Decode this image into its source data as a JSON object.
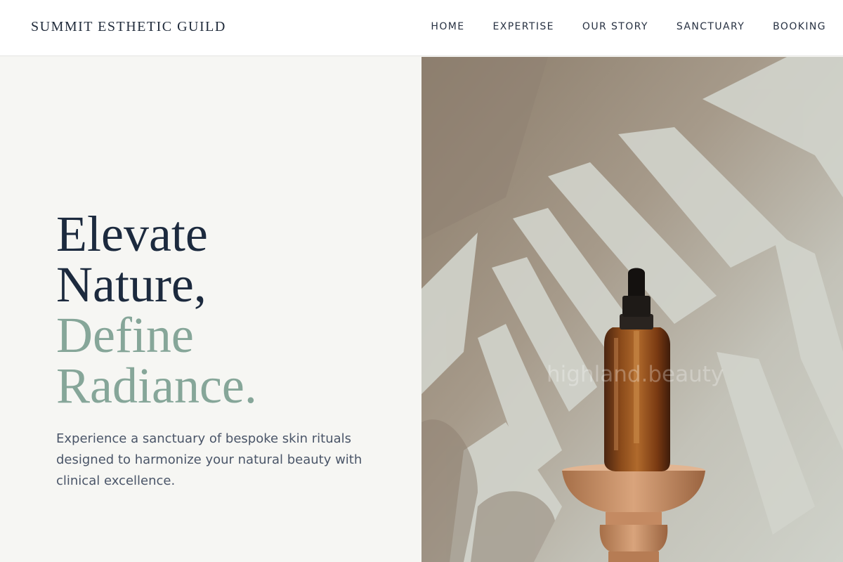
{
  "header": {
    "brand": "SUMMIT ESTHETIC GUILD",
    "nav": [
      {
        "label": "HOME"
      },
      {
        "label": "EXPERTISE"
      },
      {
        "label": "OUR STORY"
      },
      {
        "label": "SANCTUARY"
      },
      {
        "label": "BOOKING"
      }
    ]
  },
  "hero": {
    "headline": [
      "Elevate",
      "Nature,",
      "Define",
      "Radiance."
    ],
    "lead": "Experience a sanctuary of bespoke skin rituals designed to harmonize your natural beauty with clinical excellence.",
    "image_watermark": "highland.beauty"
  },
  "colors": {
    "primary_text": "#1c2a3e",
    "accent_sage": "#86a699",
    "body_text": "#4a5568",
    "background": "#f6f6f3"
  }
}
